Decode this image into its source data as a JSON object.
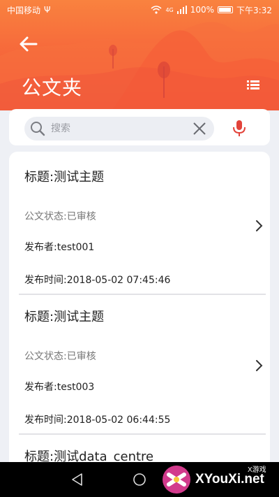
{
  "status_bar": {
    "carrier": "中国移动",
    "network": "4G",
    "battery": "100%",
    "time": "下午3:32"
  },
  "header": {
    "title": "公文夹",
    "back_icon": "back-arrow-icon",
    "menu_icon": "list-menu-icon"
  },
  "search": {
    "placeholder": "搜索",
    "value": "",
    "mic_color": "#e2433a"
  },
  "documents": [
    {
      "title": "标题:测试主题",
      "status": "公文状态:已审核",
      "publisher": "发布者:test001",
      "publish_time": "发布时间:2018-05-02 07:45:46"
    },
    {
      "title": "标题:测试主题",
      "status": "公文状态:已审核",
      "publisher": "发布者:test003",
      "publish_time": "发布时间:2018-05-02 06:44:55"
    },
    {
      "title": "标题:测试data_centre"
    }
  ],
  "watermark": {
    "brand": "XYouXi.net",
    "tag": "X游戏"
  },
  "colors": {
    "header_top": "#f9823f",
    "header_bottom": "#f14f3a",
    "background": "#eef0f5"
  }
}
